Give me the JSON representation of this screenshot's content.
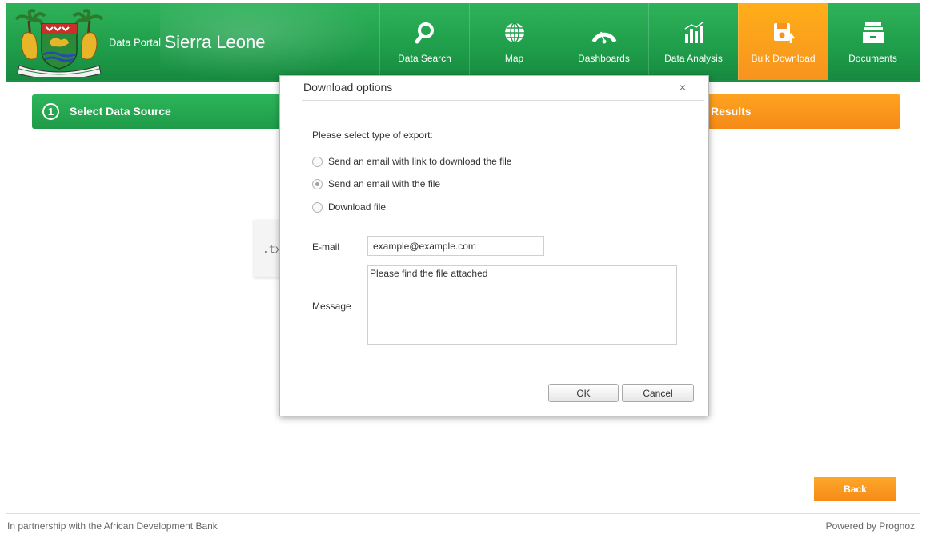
{
  "header": {
    "brand_small": "Data Portal",
    "brand_big": "Sierra Leone",
    "nav": [
      {
        "label": "Data Search",
        "icon": "search-icon"
      },
      {
        "label": "Map",
        "icon": "globe-icon"
      },
      {
        "label": "Dashboards",
        "icon": "gauge-icon"
      },
      {
        "label": "Data Analysis",
        "icon": "chart-icon"
      },
      {
        "label": "Bulk Download",
        "icon": "floppy-download-icon",
        "active": true
      },
      {
        "label": "Documents",
        "icon": "documents-icon"
      }
    ]
  },
  "steps": {
    "first_number": "1",
    "first_label": "Select Data Source",
    "last_label": "Results"
  },
  "card_text": ".tx",
  "back_label": "Back",
  "footer": {
    "left": "In partnership with the African Development Bank",
    "right": "Powered by Prognoz"
  },
  "dialog": {
    "title": "Download options",
    "close": "×",
    "prompt": "Please select type of export:",
    "options": [
      {
        "label": "Send an email with link to download the file",
        "checked": false
      },
      {
        "label": "Send an email with the file",
        "checked": true
      },
      {
        "label": "Download file",
        "checked": false
      }
    ],
    "email_label": "E-mail",
    "email_value": "example@example.com",
    "message_label": "Message",
    "message_value": "Please find the file attached",
    "ok_label": "OK",
    "cancel_label": "Cancel"
  },
  "colors": {
    "brand_green": "#1f9d4a",
    "accent_orange": "#f7931e"
  }
}
